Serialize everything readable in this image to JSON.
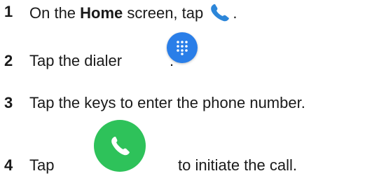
{
  "steps": [
    {
      "number": "1",
      "text_before": "On the ",
      "bold": "Home",
      "text_after": " screen, tap ",
      "end": ".",
      "icon": "phone-handset-icon"
    },
    {
      "number": "2",
      "text_before": "Tap the dialer ",
      "end": ".",
      "icon": "dialer-icon"
    },
    {
      "number": "3",
      "text": "Tap the keys to enter the phone number."
    },
    {
      "number": "4",
      "text_before": "Tap",
      "text_after": "to initiate the call.",
      "icon": "call-button-icon"
    }
  ],
  "colors": {
    "phone_icon": "#2c86d9",
    "dialer_button": "#2a7ee8",
    "call_button": "#2ec25a"
  }
}
